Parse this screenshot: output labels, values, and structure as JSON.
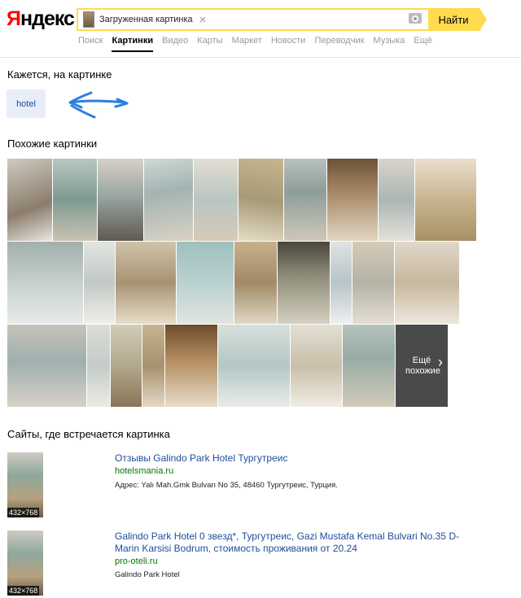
{
  "logo": {
    "first_letter": "Я",
    "rest": "ндекс"
  },
  "search": {
    "query": "Загруженная картинка",
    "clear": "×",
    "button_label": "Найти"
  },
  "nav": {
    "tabs": [
      "Поиск",
      "Картинки",
      "Видео",
      "Карты",
      "Маркет",
      "Новости",
      "Переводчик",
      "Музыка",
      "Ещё"
    ],
    "active_index": 1
  },
  "recognized": {
    "title": "Кажется, на картинке",
    "tag": "hotel"
  },
  "similar": {
    "title": "Похожие картинки",
    "more_label": "Ещё похожие",
    "more_chevron": "›"
  },
  "sites": {
    "title": "Сайты, где встречается картинка",
    "items": [
      {
        "dims": "432×768",
        "title": "Отзывы Galindo Park Hotel Тургутреис",
        "url": "hotelsmania.ru",
        "desc": "Адрес: Yalı Mah.Gmk Bulvarı No 35, 48460 Тургутреис, Турция."
      },
      {
        "dims": "432×768",
        "title": "Galindo Park Hotel 0 звезд*, Тургутреис, Gazi Mustafa Kemal Bulvari No.35 D-Marin Karsisi Bodrum, стоимость проживания от 20.24",
        "url": "pro-oteli.ru",
        "desc": "Galindo Park Hotel"
      }
    ]
  },
  "colors": {
    "accent": "#ffdb4d",
    "logo_red": "#ff0000",
    "link": "#1d4d9b",
    "url_green": "#007700",
    "tag_bg": "#e8edf8",
    "doodle": "#2a7fe0"
  }
}
